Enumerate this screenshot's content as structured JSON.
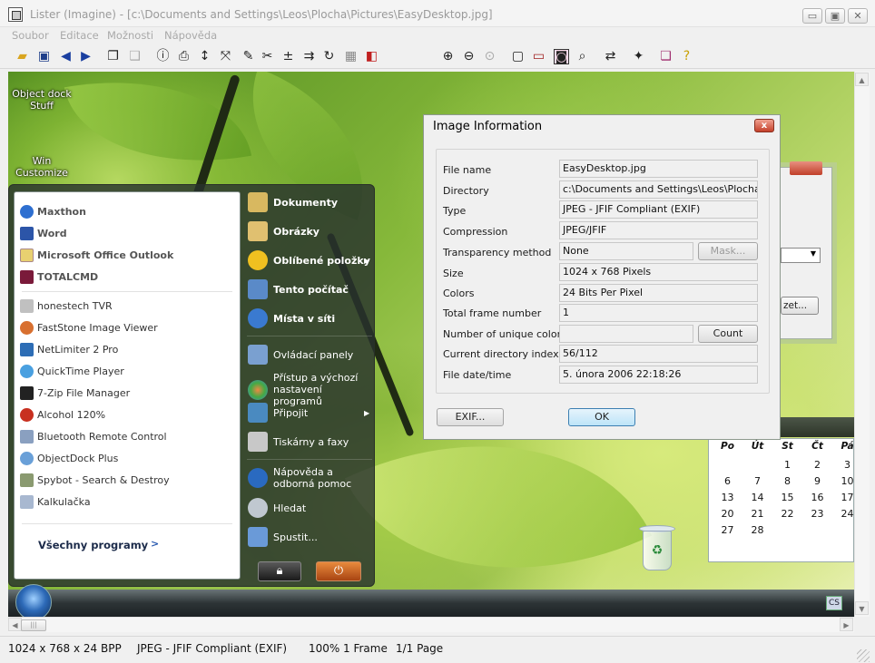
{
  "window": {
    "title": "Lister (Imagine) - [c:\\Documents and Settings\\Leos\\Plocha\\Pictures\\EasyDesktop.jpg]",
    "controls": {
      "minimize": "▭",
      "maximize": "▣",
      "close": "✕"
    }
  },
  "menu": [
    "Soubor",
    "Editace",
    "Možnosti",
    "Nápověda"
  ],
  "toolbar_icons": [
    "open-folder-icon",
    "save-icon",
    "back-arrow-icon",
    "forward-arrow-icon",
    "copy-icon",
    "paste-icon",
    "info-icon",
    "print-icon",
    "resize-icon",
    "fit-icon",
    "pen-icon",
    "crop-icon",
    "level-icon",
    "rotate-icon",
    "refresh-icon",
    "grid-icon",
    "color-icon",
    "zoom-in-icon",
    "zoom-out-icon",
    "zoom-fit-icon",
    "fullscreen-icon",
    "slideshow-icon",
    "screenshot-icon",
    "search-icon",
    "convert-icon",
    "effects-icon",
    "book-icon",
    "help-icon"
  ],
  "desktop": {
    "icon1_label_line1": "Object dock",
    "icon1_label_line2": "Stuff",
    "icon2_label_line1": "Win",
    "icon2_label_line2": "Customize"
  },
  "start_menu": {
    "pinned": [
      "Maxthon",
      "Word",
      "Microsoft Office Outlook",
      "TOTALCMD"
    ],
    "recent": [
      "honestech TVR",
      "FastStone Image Viewer",
      "NetLimiter 2 Pro",
      "QuickTime Player",
      "7-Zip File Manager",
      "Alcohol 120%",
      "Bluetooth Remote Control",
      "ObjectDock Plus",
      "Spybot - Search & Destroy",
      "Kalkulačka"
    ],
    "all_programs": "Všechny programy",
    "all_programs_arrow": ">",
    "right": {
      "dokumenty": "Dokumenty",
      "obrazky": "Obrázky",
      "oblibene": "Oblíbené položky",
      "tento_pocitac": "Tento počítač",
      "mista_v_siti": "Místa v síti",
      "ovladaci_panely": "Ovládací panely",
      "pristup_line1": "Přístup a výchozí",
      "pristup_line2": "nastavení programů",
      "pripojit": "Připojit",
      "tiskarny": "Tiskárny a faxy",
      "napoveda_line1": "Nápověda a",
      "napoveda_line2": "odborná pomoc",
      "hledat": "Hledat",
      "spustit": "Spustit..."
    }
  },
  "taskbar": {
    "lang": "CS"
  },
  "bg_window": {
    "button_label": "zet..."
  },
  "calendar": {
    "headers": [
      "Po",
      "Út",
      "St",
      "Čt",
      "Pá"
    ],
    "rows": [
      [
        "",
        "",
        "1",
        "2",
        "3"
      ],
      [
        "6",
        "7",
        "8",
        "9",
        "10"
      ],
      [
        "13",
        "14",
        "15",
        "16",
        "17"
      ],
      [
        "20",
        "21",
        "22",
        "23",
        "24"
      ],
      [
        "27",
        "28",
        "",
        "",
        ""
      ]
    ]
  },
  "dialog": {
    "title": "Image Information",
    "close": "x",
    "fields": {
      "file_name_label": "File name",
      "file_name_value": "EasyDesktop.jpg",
      "directory_label": "Directory",
      "directory_value": "c:\\Documents and Settings\\Leos\\Plocha\\Pi",
      "type_label": "Type",
      "type_value": "JPEG - JFIF Compliant (EXIF)",
      "compression_label": "Compression",
      "compression_value": "JPEG/JFIF",
      "transparency_label": "Transparency method",
      "transparency_value": "None",
      "mask_button": "Mask...",
      "size_label": "Size",
      "size_value": "1024 x 768 Pixels",
      "colors_label": "Colors",
      "colors_value": "24 Bits Per Pixel",
      "frames_label": "Total frame number",
      "frames_value": "1",
      "unique_colors_label": "Number of unique colors",
      "unique_colors_value": "",
      "count_button": "Count",
      "dir_index_label": "Current directory index",
      "dir_index_value": "56/112",
      "file_date_label": "File date/time",
      "file_date_value": "5. února 2006 22:18:26"
    },
    "exif_button": "EXIF...",
    "ok_button": "OK"
  },
  "status": {
    "dimensions": "1024 x 768 x 24 BPP",
    "format": "JPEG - JFIF Compliant (EXIF)",
    "zoom": "100%",
    "frames": "1 Frame",
    "page": "1/1 Page"
  },
  "colors": {
    "accent_blue": "#3c7fb1",
    "close_red": "#c4402a",
    "leaf_green": "#86b83a"
  }
}
